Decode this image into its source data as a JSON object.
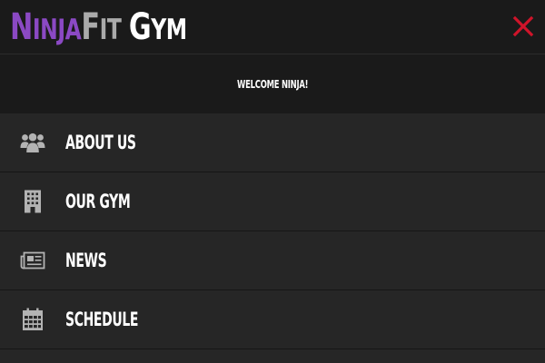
{
  "header": {
    "logo": {
      "ninja_first": "N",
      "ninja_rest": "INJA",
      "fit_first": "F",
      "fit_rest": "IT",
      "gym_first": "G",
      "gym_rest": "YM"
    },
    "close_icon": "close-icon"
  },
  "welcome": {
    "text": "WELCOME NINJA!"
  },
  "menu": {
    "items": [
      {
        "label": "ABOUT US",
        "icon": "users-icon"
      },
      {
        "label": "OUR GYM",
        "icon": "building-icon"
      },
      {
        "label": "NEWS",
        "icon": "newspaper-icon"
      },
      {
        "label": "SCHEDULE",
        "icon": "calendar-icon"
      }
    ]
  },
  "colors": {
    "accent_purple": "#8b49c4",
    "logo_grey": "#aaaaaa",
    "close_red": "#d0142a",
    "header_bg": "#1a1a1a",
    "menu_bg": "#262626",
    "icon_grey": "#b3b3b3"
  }
}
